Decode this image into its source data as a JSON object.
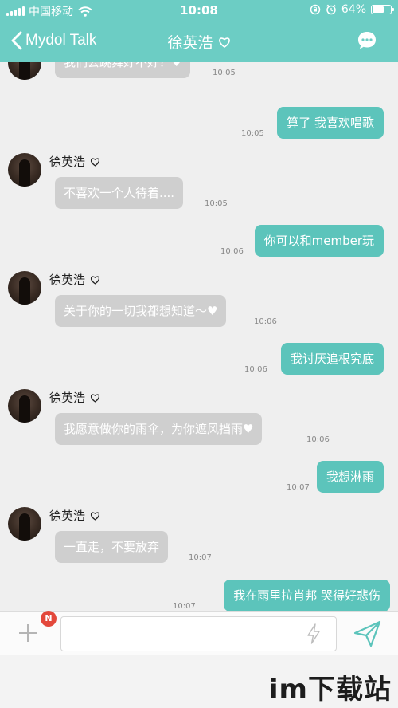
{
  "status_bar": {
    "carrier": "中国移动",
    "time": "10:08",
    "battery": "64%",
    "battery_level": 0.64
  },
  "header": {
    "back_label": "Mydol Talk",
    "title": "徐英浩",
    "icons": [
      "chevron-left-icon",
      "heart-outline-icon",
      "chat-bubble-icon"
    ]
  },
  "messages": [
    {
      "direction": "in",
      "text": "我们去跳舞好不好？♥",
      "time": "10:05"
    },
    {
      "direction": "out",
      "text": "算了 我喜欢唱歌",
      "time": "10:05"
    },
    {
      "direction": "in",
      "sender": "徐英浩",
      "text": "不喜欢一个人待着....",
      "time": "10:05"
    },
    {
      "direction": "out",
      "text": "你可以和member玩",
      "time": "10:06"
    },
    {
      "direction": "in",
      "sender": "徐英浩",
      "text": "关于你的一切我都想知道～♥",
      "time": "10:06"
    },
    {
      "direction": "out",
      "text": "我讨厌追根究底",
      "time": "10:06"
    },
    {
      "direction": "in",
      "sender": "徐英浩",
      "text": "我愿意做你的雨伞，为你遮风挡雨♥",
      "time": "10:06"
    },
    {
      "direction": "out",
      "text": "我想淋雨",
      "time": "10:07"
    },
    {
      "direction": "in",
      "sender": "徐英浩",
      "text": "一直走，不要放弃",
      "time": "10:07"
    },
    {
      "direction": "out",
      "text": "我在雨里拉肖邦 哭得好悲伤",
      "time": "10:07"
    }
  ],
  "input_bar": {
    "badge": "N",
    "placeholder": "",
    "value": "",
    "icons": [
      "plus-icon",
      "lightning-icon",
      "send-icon"
    ]
  },
  "watermark": "im下载站",
  "colors": {
    "header": "#6ccdc4",
    "outgoing_bubble": "#5cc4bb",
    "incoming_bubble": "#cfcfcf",
    "badge": "#e3483b"
  }
}
